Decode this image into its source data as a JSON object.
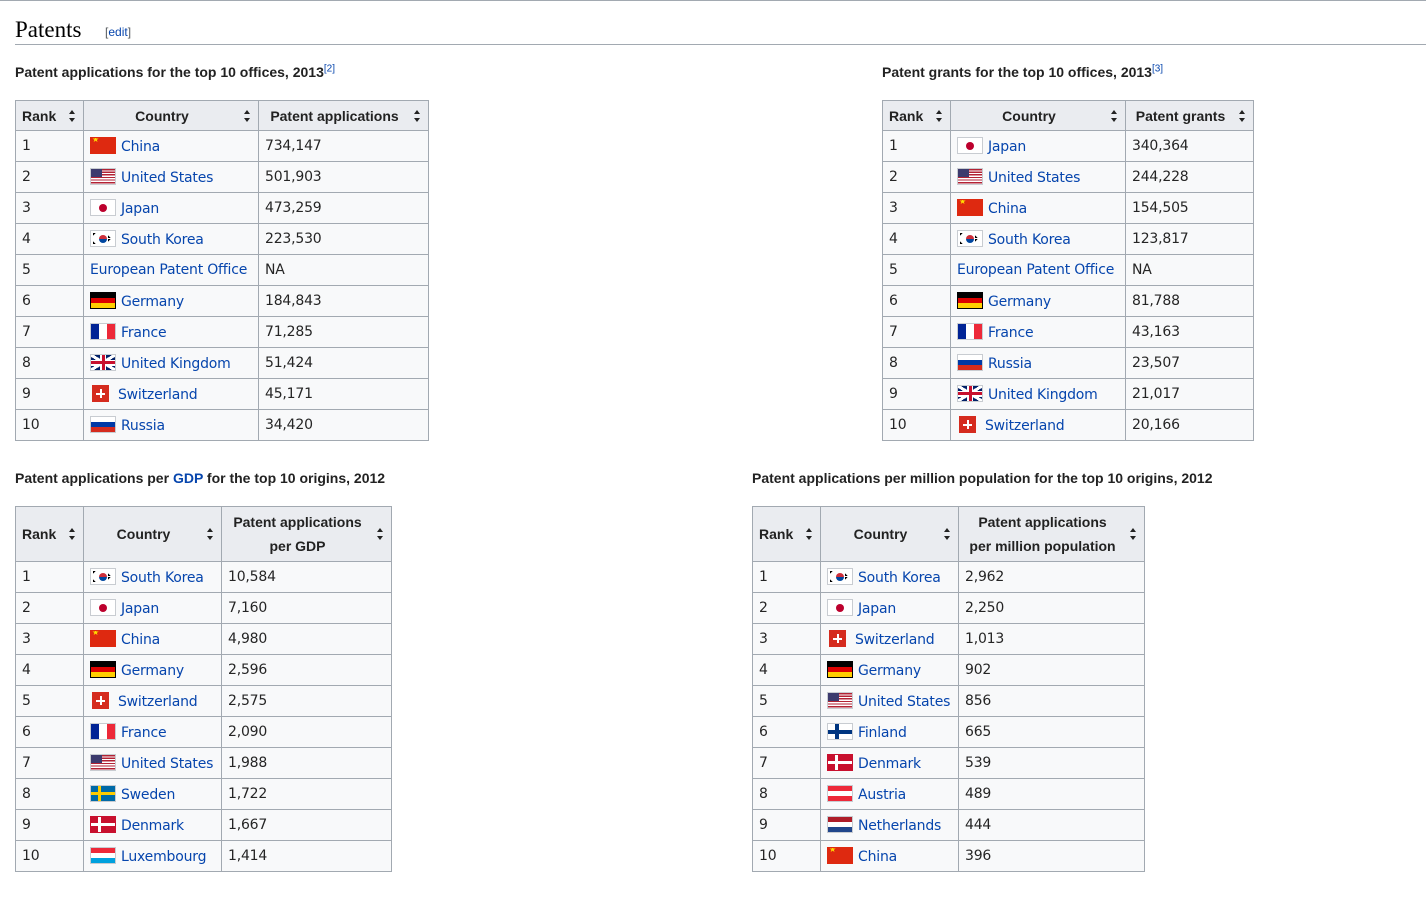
{
  "section": {
    "title": "Patents",
    "edit_open": "[",
    "edit_label": "edit",
    "edit_close": "]"
  },
  "colors": {
    "link": "#0645ad",
    "header_bg": "#eaecf0",
    "cell_bg": "#f8f9fa",
    "border": "#a2a9b1"
  },
  "tables": [
    {
      "caption": "Patent applications for the top 10 offices, 2013",
      "ref": "[2]",
      "headers": [
        "Rank",
        "Country",
        "Patent applications"
      ],
      "rows": [
        {
          "rank": "1",
          "flag": "cn",
          "country": "China",
          "value": "734,147"
        },
        {
          "rank": "2",
          "flag": "us",
          "country": "United States",
          "value": "501,903"
        },
        {
          "rank": "3",
          "flag": "jp",
          "country": "Japan",
          "value": "473,259"
        },
        {
          "rank": "4",
          "flag": "kr",
          "country": "South Korea",
          "value": "223,530"
        },
        {
          "rank": "5",
          "flag": "",
          "country": "European Patent Office",
          "value": "NA"
        },
        {
          "rank": "6",
          "flag": "de",
          "country": "Germany",
          "value": "184,843"
        },
        {
          "rank": "7",
          "flag": "fr",
          "country": "France",
          "value": "71,285"
        },
        {
          "rank": "8",
          "flag": "gb",
          "country": "United Kingdom",
          "value": "51,424"
        },
        {
          "rank": "9",
          "flag": "ch",
          "country": "Switzerland",
          "value": "45,171"
        },
        {
          "rank": "10",
          "flag": "ru",
          "country": "Russia",
          "value": "34,420"
        }
      ]
    },
    {
      "caption": "Patent grants for the top 10 offices, 2013",
      "ref": "[3]",
      "headers": [
        "Rank",
        "Country",
        "Patent grants"
      ],
      "rows": [
        {
          "rank": "1",
          "flag": "jp",
          "country": "Japan",
          "value": "340,364"
        },
        {
          "rank": "2",
          "flag": "us",
          "country": "United States",
          "value": "244,228"
        },
        {
          "rank": "3",
          "flag": "cn",
          "country": "China",
          "value": "154,505"
        },
        {
          "rank": "4",
          "flag": "kr",
          "country": "South Korea",
          "value": "123,817"
        },
        {
          "rank": "5",
          "flag": "",
          "country": "European Patent Office",
          "value": "NA"
        },
        {
          "rank": "6",
          "flag": "de",
          "country": "Germany",
          "value": "81,788"
        },
        {
          "rank": "7",
          "flag": "fr",
          "country": "France",
          "value": "43,163"
        },
        {
          "rank": "8",
          "flag": "ru",
          "country": "Russia",
          "value": "23,507"
        },
        {
          "rank": "9",
          "flag": "gb",
          "country": "United Kingdom",
          "value": "21,017"
        },
        {
          "rank": "10",
          "flag": "ch",
          "country": "Switzerland",
          "value": "20,166"
        }
      ]
    },
    {
      "caption_pre": "Patent applications per ",
      "caption_link": "GDP",
      "caption_post": " for the top 10 origins, 2012",
      "headers": [
        "Rank",
        "Country",
        "Patent applications",
        "per GDP"
      ],
      "rows": [
        {
          "rank": "1",
          "flag": "kr",
          "country": "South Korea",
          "value": "10,584"
        },
        {
          "rank": "2",
          "flag": "jp",
          "country": "Japan",
          "value": "7,160"
        },
        {
          "rank": "3",
          "flag": "cn",
          "country": "China",
          "value": "4,980"
        },
        {
          "rank": "4",
          "flag": "de",
          "country": "Germany",
          "value": "2,596"
        },
        {
          "rank": "5",
          "flag": "ch",
          "country": "Switzerland",
          "value": "2,575"
        },
        {
          "rank": "6",
          "flag": "fr",
          "country": "France",
          "value": "2,090"
        },
        {
          "rank": "7",
          "flag": "us",
          "country": "United States",
          "value": "1,988"
        },
        {
          "rank": "8",
          "flag": "se",
          "country": "Sweden",
          "value": "1,722"
        },
        {
          "rank": "9",
          "flag": "dk",
          "country": "Denmark",
          "value": "1,667"
        },
        {
          "rank": "10",
          "flag": "lu",
          "country": "Luxembourg",
          "value": "1,414"
        }
      ]
    },
    {
      "caption": "Patent applications per million population for the top 10 origins, 2012",
      "headers": [
        "Rank",
        "Country",
        "Patent applications",
        "per million population"
      ],
      "rows": [
        {
          "rank": "1",
          "flag": "kr",
          "country": "South Korea",
          "value": "2,962"
        },
        {
          "rank": "2",
          "flag": "jp",
          "country": "Japan",
          "value": "2,250"
        },
        {
          "rank": "3",
          "flag": "ch",
          "country": "Switzerland",
          "value": "1,013"
        },
        {
          "rank": "4",
          "flag": "de",
          "country": "Germany",
          "value": "902"
        },
        {
          "rank": "5",
          "flag": "us",
          "country": "United States",
          "value": "856"
        },
        {
          "rank": "6",
          "flag": "fi",
          "country": "Finland",
          "value": "665"
        },
        {
          "rank": "7",
          "flag": "dk",
          "country": "Denmark",
          "value": "539"
        },
        {
          "rank": "8",
          "flag": "at",
          "country": "Austria",
          "value": "489"
        },
        {
          "rank": "9",
          "flag": "nl",
          "country": "Netherlands",
          "value": "444"
        },
        {
          "rank": "10",
          "flag": "cn",
          "country": "China",
          "value": "396"
        }
      ]
    }
  ]
}
